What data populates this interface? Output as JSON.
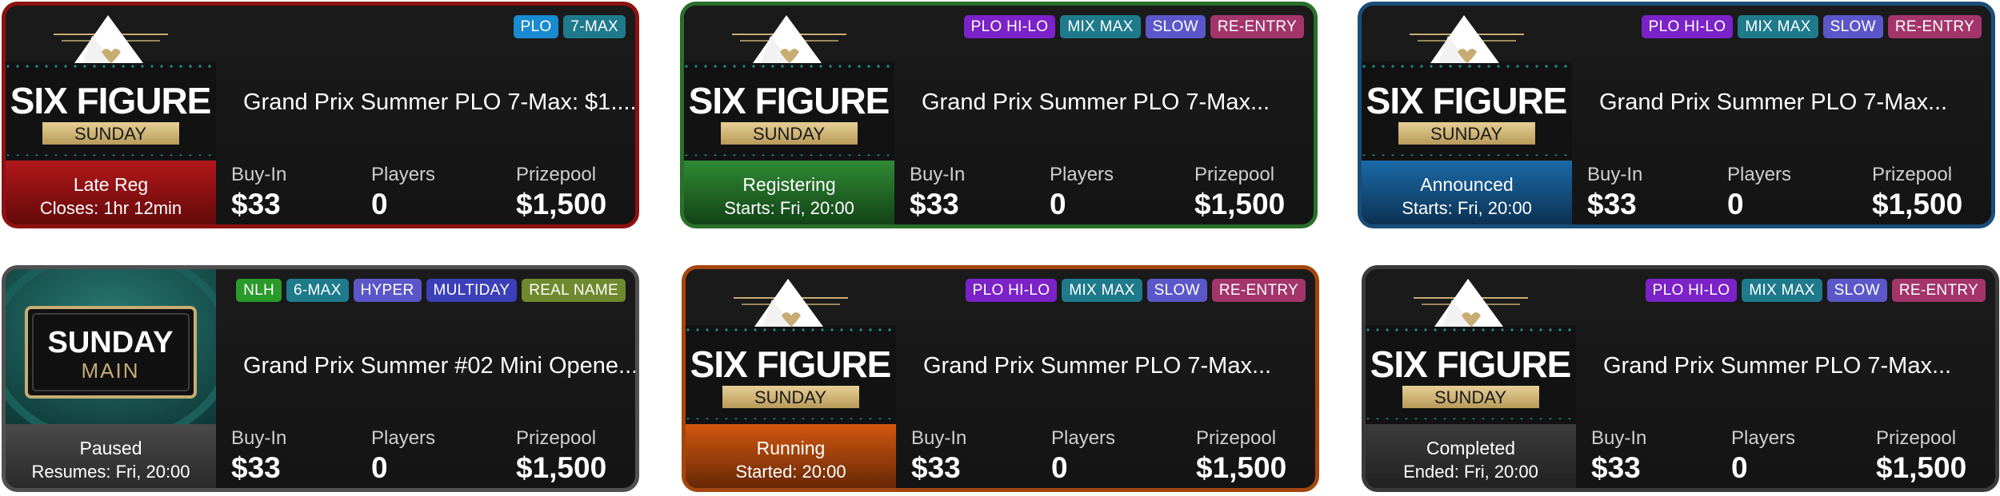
{
  "labels": {
    "buyin": "Buy-In",
    "players": "Players",
    "prizepool": "Prizepool"
  },
  "logos": {
    "six_figure": {
      "line1": "SIX FIGURE",
      "line2": "SUNDAY"
    },
    "sunday_main": {
      "line1": "SUNDAY",
      "line2": "MAIN"
    }
  },
  "badge_colors": {
    "PLO": "#1a8ad1",
    "7-MAX": "#1f7a8c",
    "PLO HI-LO": "#7b22c8",
    "MIX MAX": "#1f7a8c",
    "SLOW": "#5b57c9",
    "RE-ENTRY": "#a3356b",
    "NLH": "#2a9a2a",
    "6-MAX": "#1f7a8c",
    "HYPER": "#5b57c9",
    "MULTIDAY": "#3b3fb8",
    "REAL NAME": "#6f8a2e"
  },
  "cards": [
    {
      "status": "Late Reg",
      "status_detail": "Closes: 1hr 12min",
      "status_color": "#8e1111",
      "badges": [
        "PLO",
        "7-MAX"
      ],
      "title": "Grand Prix Summer PLO 7-Max: $1....",
      "buyin": "$33",
      "players": "0",
      "prizepool": "$1,500",
      "logo": "six_figure"
    },
    {
      "status": "Registering",
      "status_detail": "Starts: Fri, 20:00",
      "status_color": "#2a6f2a",
      "badges": [
        "PLO HI-LO",
        "MIX MAX",
        "SLOW",
        "RE-ENTRY"
      ],
      "title": "Grand Prix Summer PLO 7-Max...",
      "buyin": "$33",
      "players": "0",
      "prizepool": "$1,500",
      "logo": "six_figure"
    },
    {
      "status": "Announced",
      "status_detail": "Starts: Fri, 20:00",
      "status_color": "#1b4d78",
      "badges": [
        "PLO HI-LO",
        "MIX MAX",
        "SLOW",
        "RE-ENTRY"
      ],
      "title": "Grand Prix Summer PLO 7-Max...",
      "buyin": "$33",
      "players": "0",
      "prizepool": "$1,500",
      "logo": "six_figure"
    },
    {
      "status": "Paused",
      "status_detail": "Resumes: Fri, 20:00",
      "status_color": "#505050",
      "badges": [
        "NLH",
        "6-MAX",
        "HYPER",
        "MULTIDAY",
        "REAL NAME"
      ],
      "title": "Grand Prix Summer #02 Mini Opene...",
      "buyin": "$33",
      "players": "0",
      "prizepool": "$1,500",
      "logo": "sunday_main"
    },
    {
      "status": "Running",
      "status_detail": "Started: 20:00",
      "status_color": "#a4460f",
      "badges": [
        "PLO HI-LO",
        "MIX MAX",
        "SLOW",
        "RE-ENTRY"
      ],
      "title": "Grand Prix Summer PLO 7-Max...",
      "buyin": "$33",
      "players": "0",
      "prizepool": "$1,500",
      "logo": "six_figure"
    },
    {
      "status": "Completed",
      "status_detail": "Ended: Fri, 20:00",
      "status_color": "#3a3a3a",
      "badges": [
        "PLO HI-LO",
        "MIX MAX",
        "SLOW",
        "RE-ENTRY"
      ],
      "title": "Grand Prix Summer PLO 7-Max...",
      "buyin": "$33",
      "players": "0",
      "prizepool": "$1,500",
      "logo": "six_figure"
    }
  ]
}
